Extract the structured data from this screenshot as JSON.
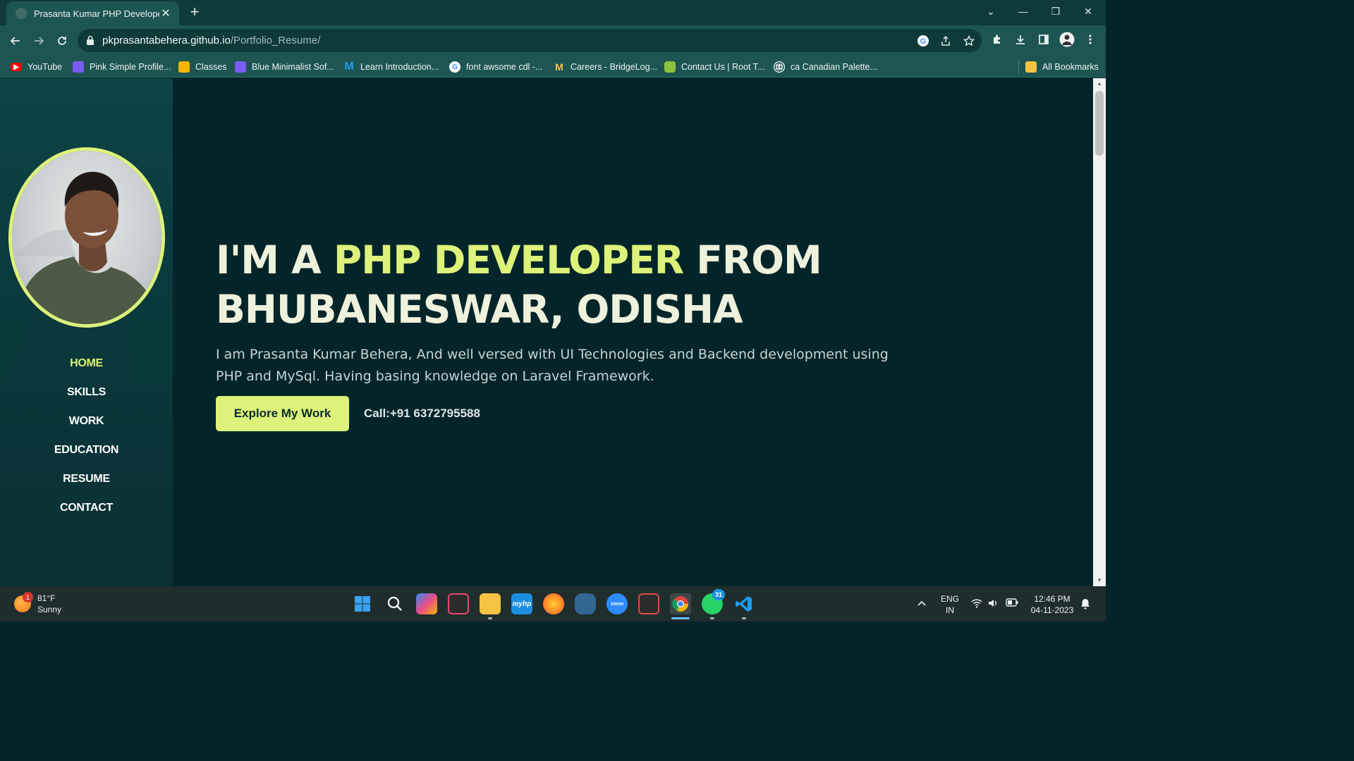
{
  "browser": {
    "tab_title": "Prasanta Kumar PHP Developer",
    "tab_close": "✕",
    "new_tab": "+",
    "url_domain": "pkprasantabehera.github.io",
    "url_path": "/Portfolio_Resume/",
    "window_controls": {
      "list": "⌄",
      "minimize": "—",
      "restore": "❐",
      "close": "✕"
    },
    "bookmarks": [
      {
        "label": "YouTube",
        "icon": "youtube-icon",
        "color": "#ff0000"
      },
      {
        "label": "Pink Simple Profile...",
        "icon": "canva-doc-icon",
        "color": "#7b5cf0"
      },
      {
        "label": "Classes",
        "icon": "classroom-icon",
        "color": "#f4b400"
      },
      {
        "label": "Blue Minimalist Sof...",
        "icon": "canva-doc-icon",
        "color": "#7b5cf0"
      },
      {
        "label": "Learn Introduction...",
        "icon": "m-logo-icon",
        "color": "#1fa0e6"
      },
      {
        "label": "font awsome cdl -...",
        "icon": "google-icon",
        "color": "#ffffff"
      },
      {
        "label": "Careers - BridgeLog...",
        "icon": "bridgelogic-icon",
        "color": "#f6c343"
      },
      {
        "label": "Contact Us | Root T...",
        "icon": "roottech-icon",
        "color": "#8ac43f"
      },
      {
        "label": "ca Canadian Palette...",
        "icon": "globe-icon",
        "color": "#ffffff"
      }
    ],
    "all_bookmarks": "All Bookmarks"
  },
  "sidebar": {
    "nav": [
      "HOME",
      "SKILLS",
      "WORK",
      "EDUCATION",
      "RESUME",
      "CONTACT"
    ],
    "active_index": 0
  },
  "hero": {
    "title_pre": "I'M A ",
    "title_accent": "PHP DEVELOPER",
    "title_post": " FROM BHUBANESWAR, ODISHA",
    "description": "I am Prasanta Kumar Behera, And well versed with UI Technologies and Backend development using PHP and MySql. Having basing knowledge on Laravel Framework.",
    "cta_label": "Explore My Work",
    "call_text": "Call:+91 6372795588"
  },
  "colors": {
    "accent": "#dcf27a",
    "background": "#03252a",
    "sidebar": "#0b3a3d",
    "chrome": "#1d5552"
  },
  "taskbar": {
    "weather_temp": "81°F",
    "weather_desc": "Sunny",
    "weather_badge": "1",
    "whatsapp_badge": "31",
    "lang_top": "ENG",
    "lang_bottom": "IN",
    "time": "12:46 PM",
    "date": "04-11-2023",
    "apps": [
      "start-icon",
      "search-icon",
      "copilot-icon",
      "snipping-icon",
      "file-explorer-icon",
      "myhp-icon",
      "firefox-icon",
      "postgres-icon",
      "zoom-icon",
      "screen-recorder-icon",
      "chrome-icon",
      "whatsapp-icon",
      "vscode-icon"
    ]
  }
}
